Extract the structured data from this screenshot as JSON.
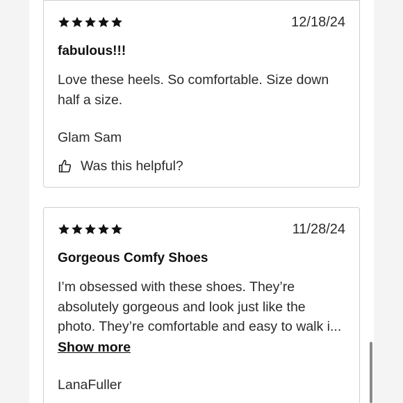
{
  "reviews": [
    {
      "rating": 5,
      "date": "12/18/24",
      "title": "fabulous!!!",
      "body_lines": [
        "Love these heels. So comfortable. Size down",
        "half a size."
      ],
      "author": "Glam Sam",
      "helpful_label": "Was this helpful?"
    },
    {
      "rating": 5,
      "date": "11/28/24",
      "title": "Gorgeous Comfy Shoes",
      "body_lines": [
        "I’m obsessed with these shoes. They’re",
        "absolutely gorgeous and look just like the",
        "photo. They’re comfortable and easy to walk i..."
      ],
      "show_more_label": "Show more",
      "author": "LanaFuller"
    }
  ],
  "icons": {
    "star": "star-icon",
    "helpful": "thumbs-up-icon"
  }
}
